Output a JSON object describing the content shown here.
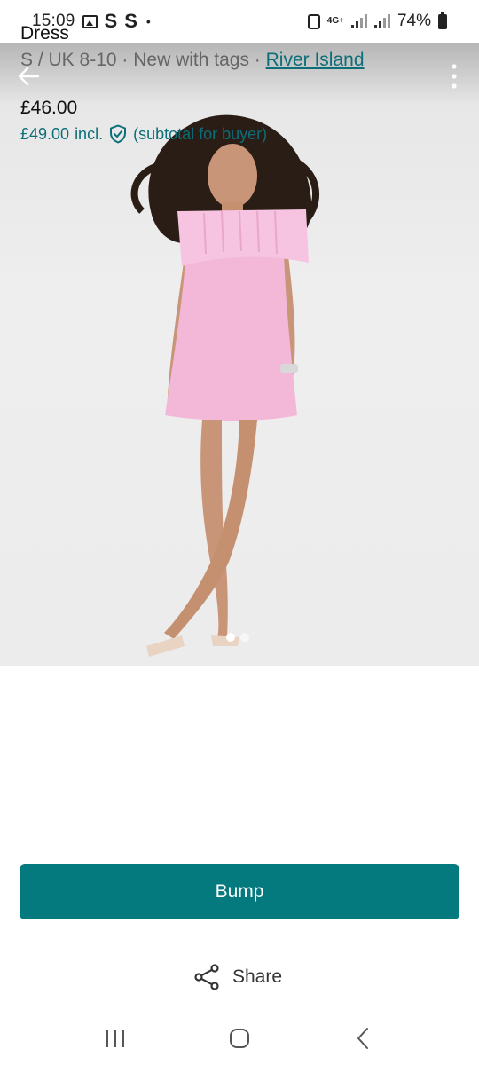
{
  "status_bar": {
    "time": "15:09",
    "letters": [
      "S",
      "S"
    ],
    "dot": "•",
    "network": "4G+",
    "battery": "74%"
  },
  "hero": {
    "image_description_icon": "product-photo",
    "page_count": 2,
    "current_page": 1
  },
  "item": {
    "title": "Dress",
    "size": "S / UK 8-10",
    "separator": " · ",
    "condition": "New with tags",
    "brand": "River Island",
    "price": "£46.00",
    "price_incl": "£49.00",
    "incl_label": "incl.",
    "subtotal_note": "(subtotal for buyer)"
  },
  "actions": {
    "bump_label": "Bump",
    "share_label": "Share"
  },
  "colors": {
    "accent": "#047a7f",
    "link": "#0b6e78",
    "dress": "#f3b8d8"
  }
}
